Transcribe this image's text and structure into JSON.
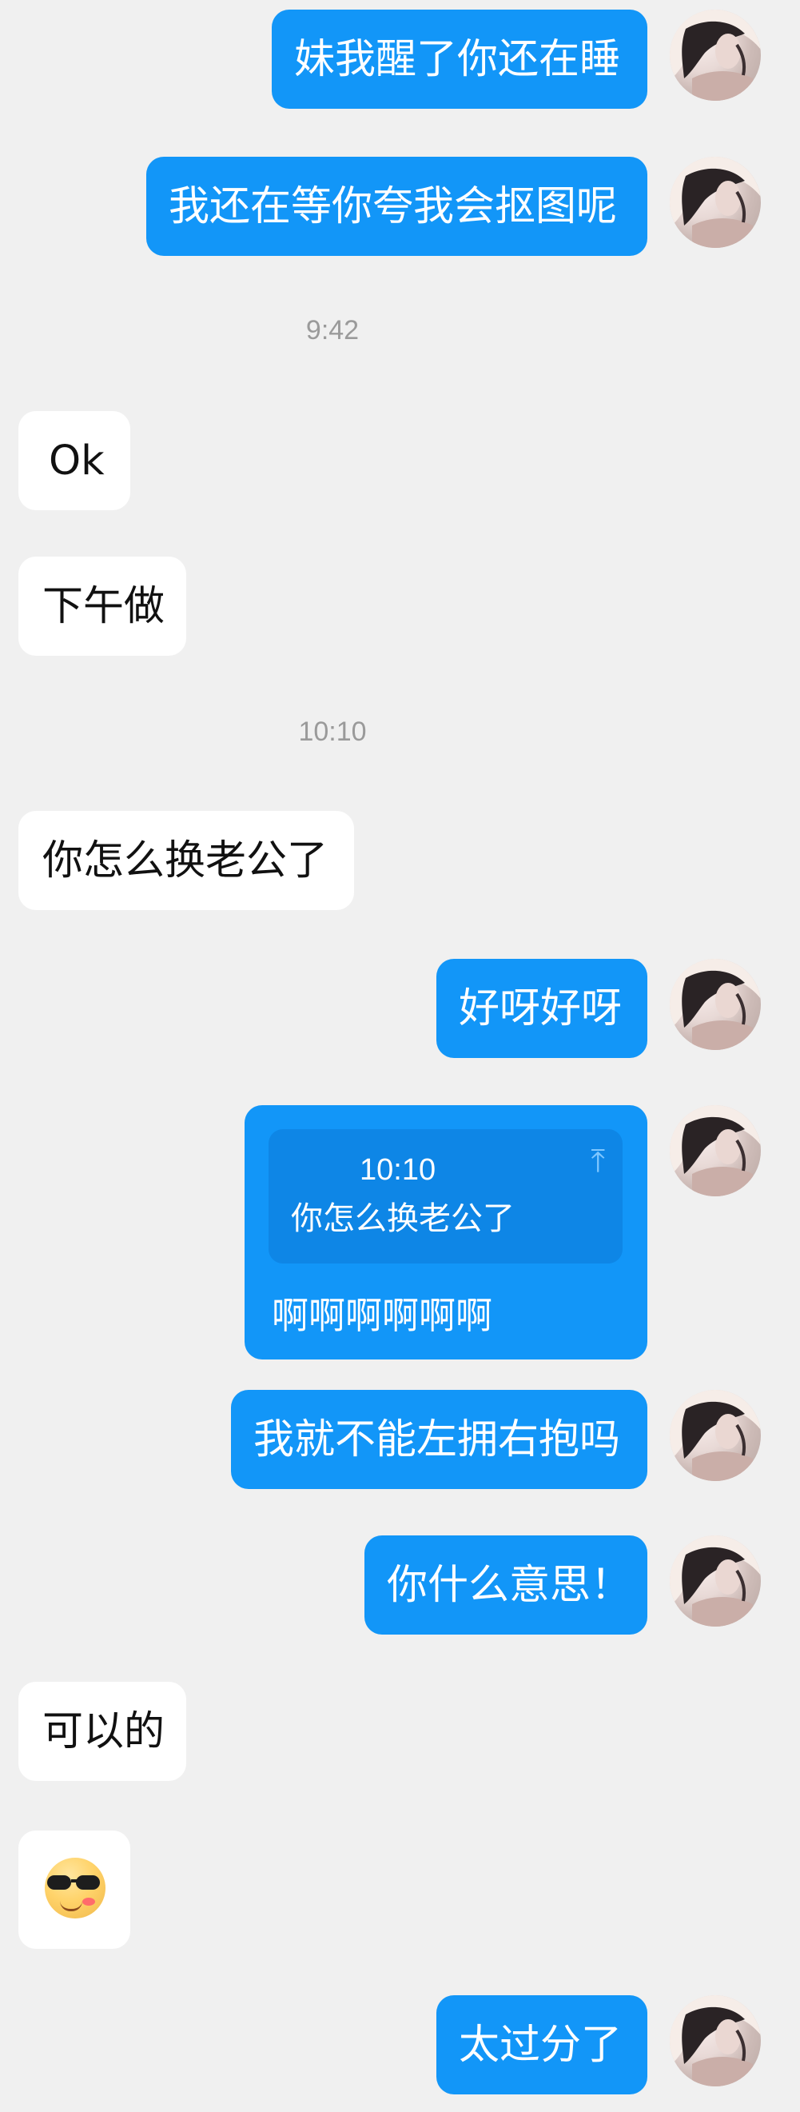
{
  "messages": [
    {
      "text": "妹我醒了你还在睡"
    },
    {
      "text": "我还在等你夸我会抠图呢"
    },
    {
      "text": "9:42"
    },
    {
      "text": "Ok"
    },
    {
      "text": "下午做"
    },
    {
      "text": "10:10"
    },
    {
      "text": "你怎么换老公了"
    },
    {
      "text": "好呀好呀"
    },
    {
      "text": "我就不能左拥右抱吗"
    },
    {
      "text": "你什么意思！"
    },
    {
      "text": "可以的"
    },
    {
      "text": "太过分了"
    }
  ],
  "quoted": {
    "time": "10:10",
    "text": "你怎么换老公了",
    "reply": "啊啊啊啊啊啊"
  },
  "icons": {
    "avatar": "avatar",
    "scroll_up": "arrow-up-icon",
    "emoji": "smile-sunglasses-icon"
  },
  "colors": {
    "background": "#f0f0f0",
    "outgoing": "#1296f8",
    "incoming": "#ffffff",
    "quote": "#0e86e6"
  }
}
